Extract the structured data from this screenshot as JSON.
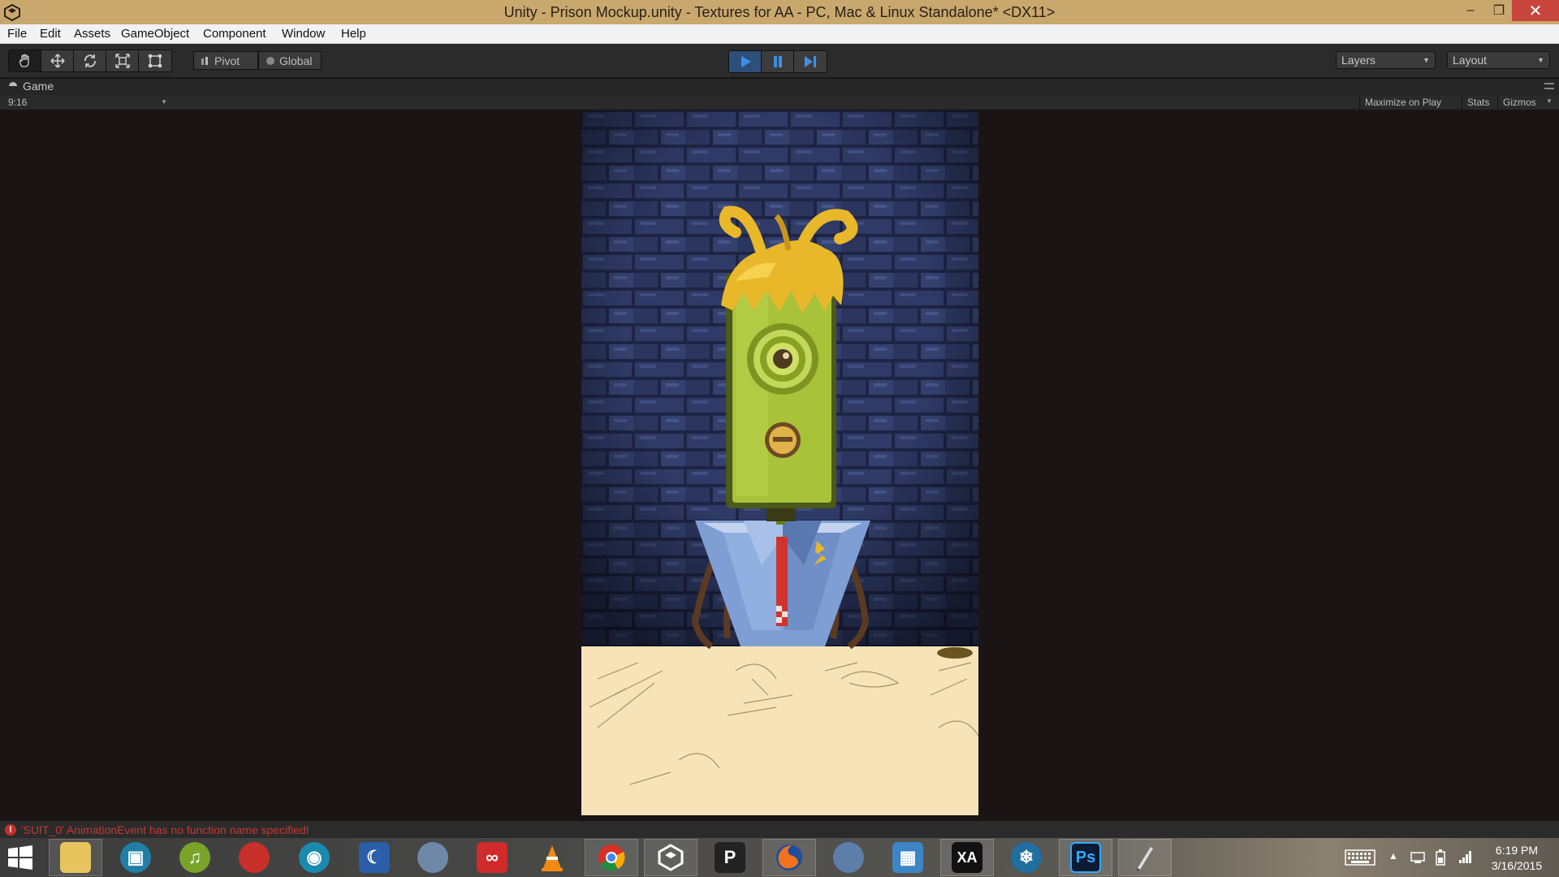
{
  "window": {
    "title": "Unity - Prison Mockup.unity - Textures for AA - PC, Mac & Linux Standalone* <DX11>",
    "minimize_glyph": "–",
    "maximize_glyph": "❐",
    "close_glyph": "✕"
  },
  "menu": {
    "items": [
      "File",
      "Edit",
      "Assets",
      "GameObject",
      "Component",
      "Window",
      "Help"
    ]
  },
  "toolbar": {
    "transform_tools": [
      "hand-icon",
      "move-icon",
      "rotate-icon",
      "scale-icon",
      "rect-icon"
    ],
    "pivot_label": "Pivot",
    "global_label": "Global",
    "layers_label": "Layers",
    "layout_label": "Layout"
  },
  "game_panel": {
    "tab_label": "Game",
    "aspect": "9:16",
    "maximize_on_play": "Maximize on Play",
    "stats": "Stats",
    "gizmos": "Gizmos"
  },
  "status": {
    "message": "'SUIT_0' AnimationEvent has no function name specified!",
    "level_color": "#c33a30"
  },
  "taskbar": {
    "apps": [
      "windows-start-icon",
      "file-explorer-icon",
      "media-player-icon",
      "itunes-icon",
      "audio-app-icon",
      "circle-app-icon",
      "crescent-app-icon",
      "globe-app-icon",
      "creative-cloud-icon",
      "vlc-icon",
      "chrome-icon",
      "unity-icon",
      "p-app-icon",
      "firefox-icon",
      "bird-app-icon",
      "remote-desktop-icon",
      "xa-app-icon",
      "snowflake-app-icon",
      "photoshop-icon",
      "pen-app-icon"
    ],
    "p_label": "P",
    "ps_label": "Ps",
    "xa_label": "XA",
    "time": "6:19 PM",
    "date": "3/16/2015"
  },
  "colors": {
    "accent_play": "#3f8fe6",
    "titlebar": "#c9a86e",
    "brick": "#2c355c",
    "floor": "#f7e3b8",
    "creature_green": "#a8c23a",
    "hair_gold": "#e8b82a",
    "suit_blue": "#7f9fd4",
    "tie_red": "#d0322c"
  }
}
